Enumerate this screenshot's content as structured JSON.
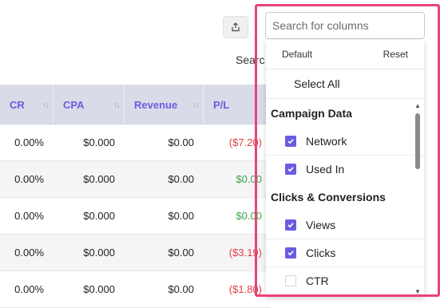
{
  "toolbar": {
    "export_icon": "share-upload-icon",
    "search_label": "Searc"
  },
  "table": {
    "headers": [
      "CR",
      "CPA",
      "Revenue",
      "P/L"
    ],
    "rows": [
      {
        "cr": "0.00%",
        "cpa": "$0.000",
        "revenue": "$0.00",
        "pl": "($7.20)"
      },
      {
        "cr": "0.00%",
        "cpa": "$0.000",
        "revenue": "$0.00",
        "pl": "$0.00"
      },
      {
        "cr": "0.00%",
        "cpa": "$0.000",
        "revenue": "$0.00",
        "pl": "$0.00"
      },
      {
        "cr": "0.00%",
        "cpa": "$0.000",
        "revenue": "$0.00",
        "pl": "($3.19)"
      },
      {
        "cr": "0.00%",
        "cpa": "$0.000",
        "revenue": "$0.00",
        "pl": "($1.80)"
      }
    ]
  },
  "columns_picker": {
    "search_placeholder": "Search for columns",
    "default_label": "Default",
    "reset_label": "Reset",
    "select_all_label": "Select All",
    "groups": [
      {
        "title": "Campaign Data",
        "items": [
          {
            "label": "Network",
            "checked": true
          },
          {
            "label": "Used In",
            "checked": true
          }
        ]
      },
      {
        "title": "Clicks & Conversions",
        "items": [
          {
            "label": "Views",
            "checked": true
          },
          {
            "label": "Clicks",
            "checked": true
          },
          {
            "label": "CTR",
            "checked": false
          }
        ]
      }
    ]
  },
  "colors": {
    "accent": "#6a5ce0",
    "highlight": "#e8437a",
    "negative": "#e04040",
    "positive": "#3aa349"
  }
}
